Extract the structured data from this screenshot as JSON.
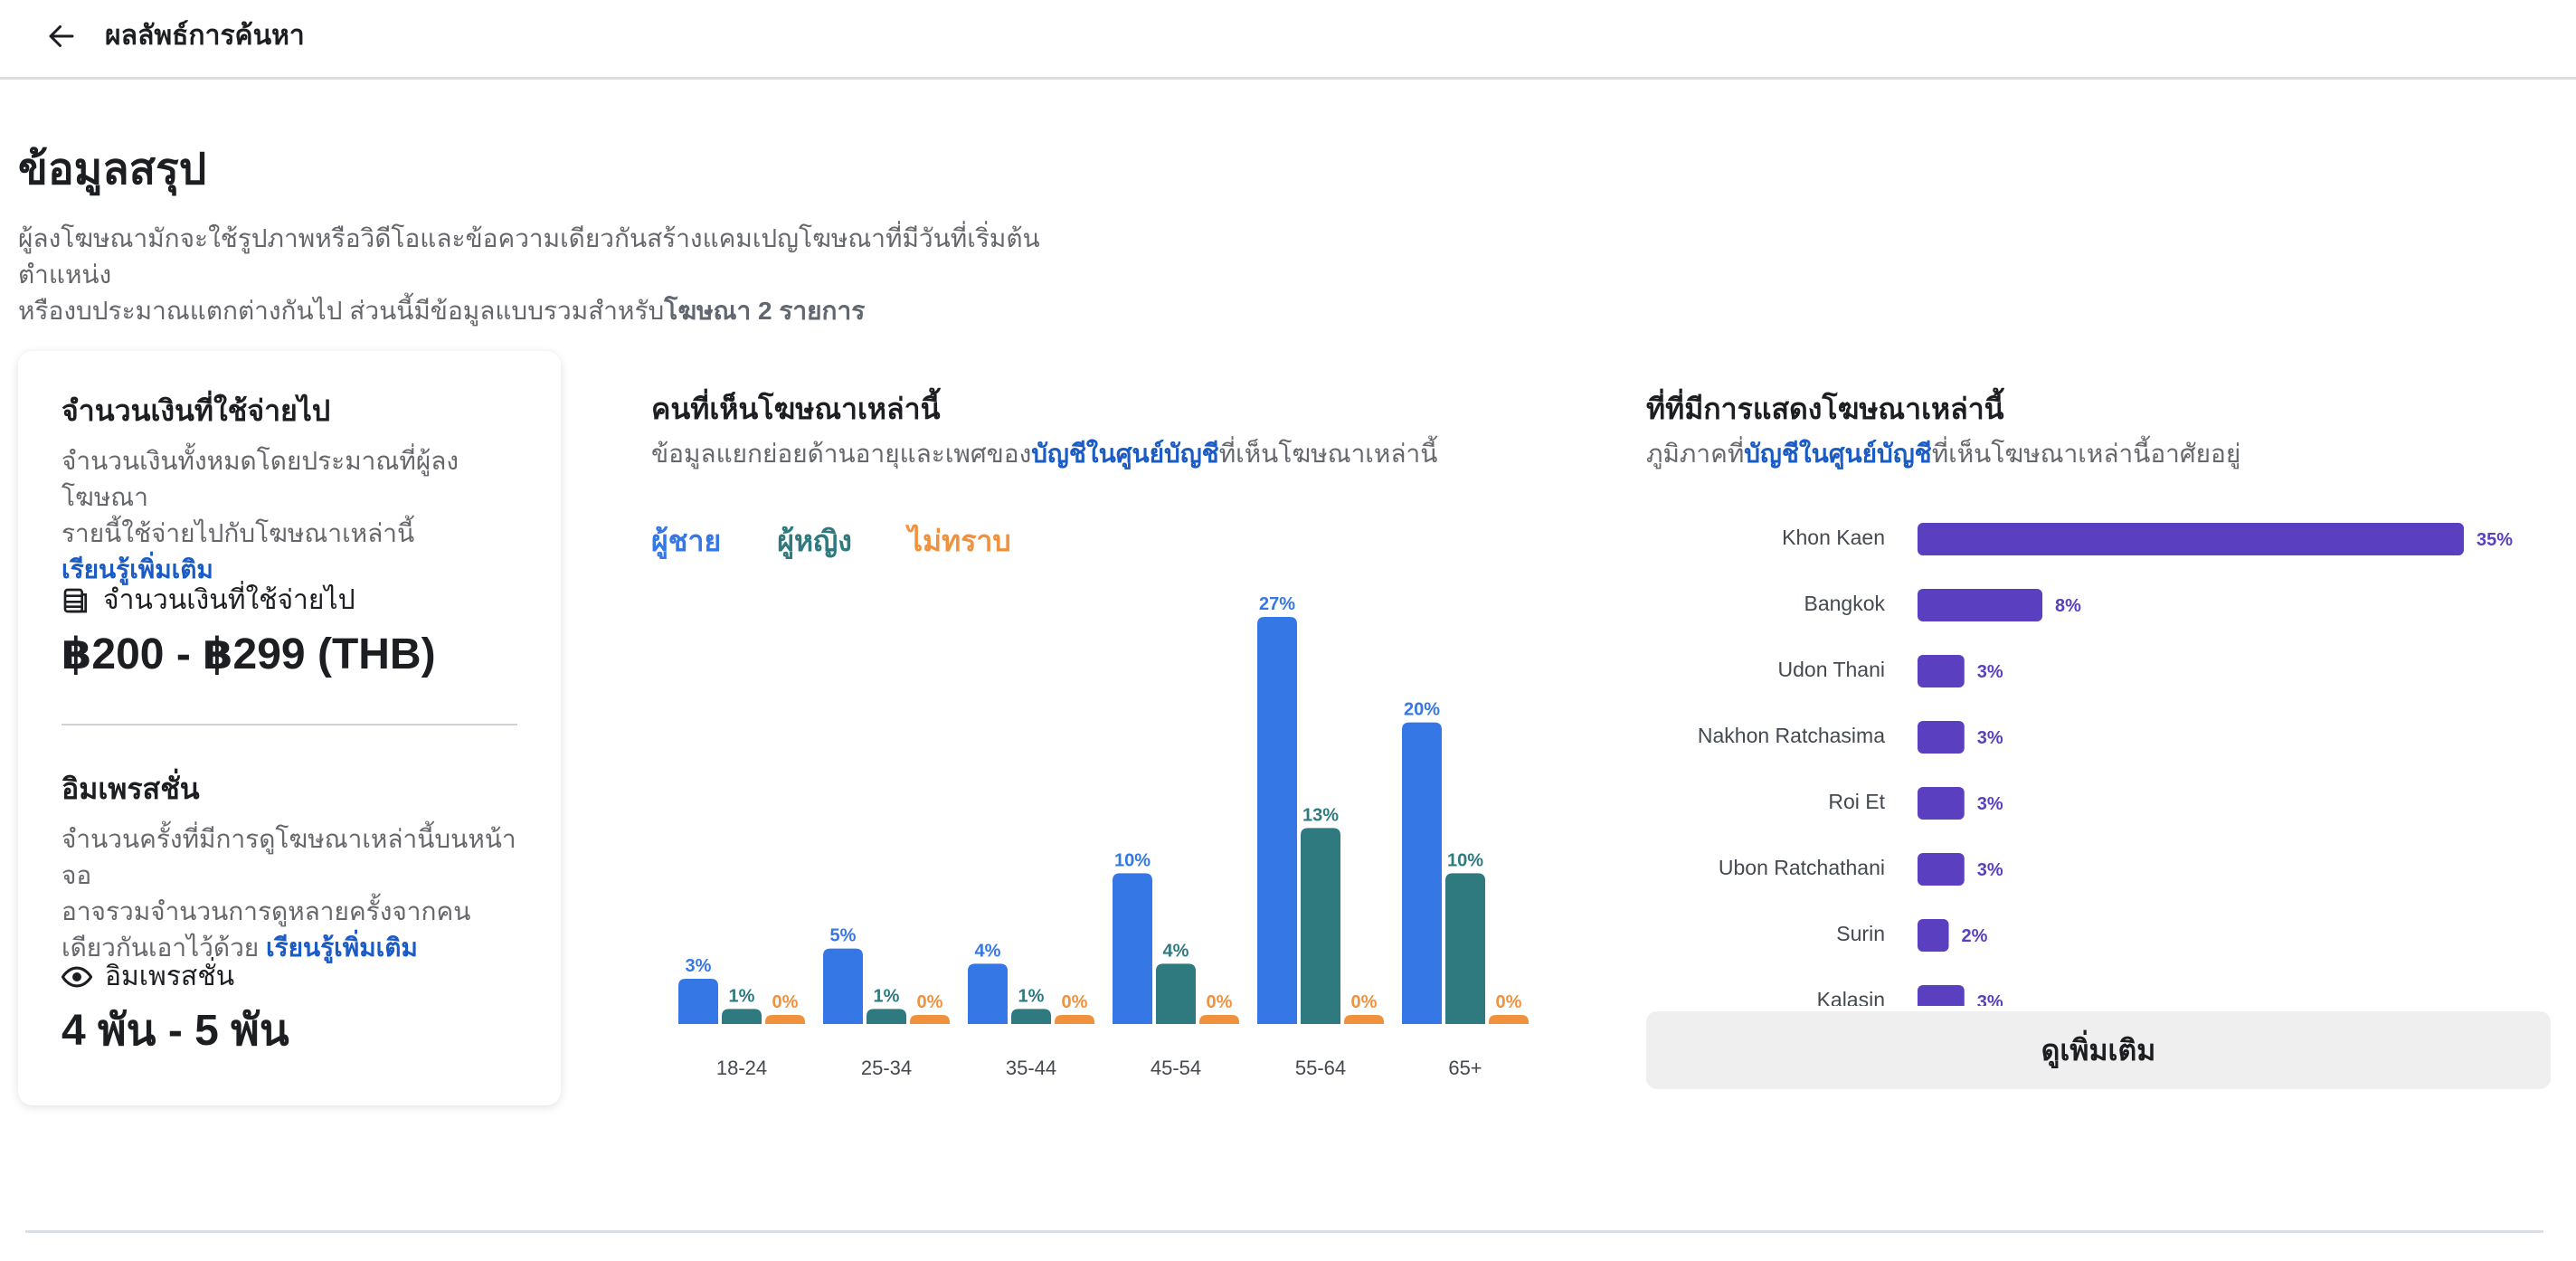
{
  "header": {
    "back_icon": "arrow-left-icon",
    "title": "ผลลัพธ์การค้นหา"
  },
  "summary": {
    "title": "ข้อมูลสรุป",
    "desc_line1": "ผู้ลงโฆษณามักจะใช้รูปภาพหรือวิดีโอและข้อความเดียวกันสร้างแคมเปญโฆษณาที่มีวันที่เริ่มต้น ตำแหน่ง",
    "desc_line2_prefix": "หรืองบประมาณแตกต่างกันไป ส่วนนี้มีข้อมูลแบบรวมสำหรับ",
    "desc_line2_bold": "โฆษณา 2 รายการ"
  },
  "spend": {
    "heading": "จำนวนเงินที่ใช้จ่ายไป",
    "desc_line1": "จำนวนเงินทั้งหมดโดยประมาณที่ผู้ลงโฆษณา",
    "desc_line2": "รายนี้ใช้จ่ายไปกับโฆษณาเหล่านี้",
    "learn_more": "เรียนรู้เพิ่มเติม",
    "metric_icon": "money-stack-icon",
    "metric_label": "จำนวนเงินที่ใช้จ่ายไป",
    "metric_value": "฿200 - ฿299 (THB)"
  },
  "impressions": {
    "heading": "อิมเพรสชั่น",
    "desc_line1": "จำนวนครั้งที่มีการดูโฆษณาเหล่านี้บนหน้าจอ",
    "desc_line2": "อาจรวมจำนวนการดูหลายครั้งจากคน",
    "desc_line3": "เดียวกันเอาไว้ด้วย",
    "learn_more": "เรียนรู้เพิ่มเติม",
    "metric_icon": "eye-icon",
    "metric_label": "อิมเพรสชั่น",
    "metric_value": "4 พัน - 5 พัน"
  },
  "age_gender": {
    "heading": "คนที่เห็นโฆษณาเหล่านี้",
    "sub_prefix": "ข้อมูลแยกย่อยด้านอายุและเพศของ",
    "sub_link": "บัญชีในศูนย์บัญชี",
    "sub_suffix": "ที่เห็นโฆษณาเหล่านี้",
    "legend": {
      "male": "ผู้ชาย",
      "female": "ผู้หญิง",
      "unknown": "ไม่ทราบ"
    }
  },
  "location": {
    "heading": "ที่ที่มีการแสดงโฆษณาเหล่านี้",
    "sub_prefix": "ภูมิภาคที่",
    "sub_link": "บัญชีในศูนย์บัญชี",
    "sub_suffix": "ที่เห็นโฆษณาเหล่านี้อาศัยอยู่",
    "see_more": "ดูเพิ่มเติม"
  },
  "colors": {
    "male": "#3578e5",
    "female": "#2f7a7f",
    "unknown": "#f0913e",
    "location_bar": "#5a3fc0",
    "link": "#1a5bc4"
  },
  "chart_data": [
    {
      "type": "bar",
      "categories": [
        "18-24",
        "25-34",
        "35-44",
        "45-54",
        "55-64",
        "65+"
      ],
      "series": [
        {
          "name": "ผู้ชาย",
          "values": [
            3,
            5,
            4,
            10,
            27,
            20
          ],
          "labels": [
            "3%",
            "5%",
            "4%",
            "10%",
            "27%",
            "20%"
          ]
        },
        {
          "name": "ผู้หญิง",
          "values": [
            1,
            1,
            1,
            4,
            13,
            10
          ],
          "labels": [
            "1%",
            "1%",
            "1%",
            "4%",
            "13%",
            "10%"
          ]
        },
        {
          "name": "ไม่ทราบ",
          "values": [
            0,
            0,
            0,
            0,
            0,
            0
          ],
          "labels": [
            "0%",
            "0%",
            "0%",
            "0%",
            "0%",
            "0%"
          ]
        }
      ],
      "ylim": [
        0,
        27
      ]
    },
    {
      "type": "bar",
      "orientation": "horizontal",
      "categories": [
        "Khon Kaen",
        "Bangkok",
        "Udon Thani",
        "Nakhon Ratchasima",
        "Roi Et",
        "Ubon Ratchathani",
        "Surin",
        "Kalasin"
      ],
      "values": [
        35,
        8,
        3,
        3,
        3,
        3,
        2,
        3
      ],
      "labels": [
        "35%",
        "8%",
        "3%",
        "3%",
        "3%",
        "3%",
        "2%",
        "3%"
      ],
      "xlim": [
        0,
        35
      ]
    }
  ]
}
